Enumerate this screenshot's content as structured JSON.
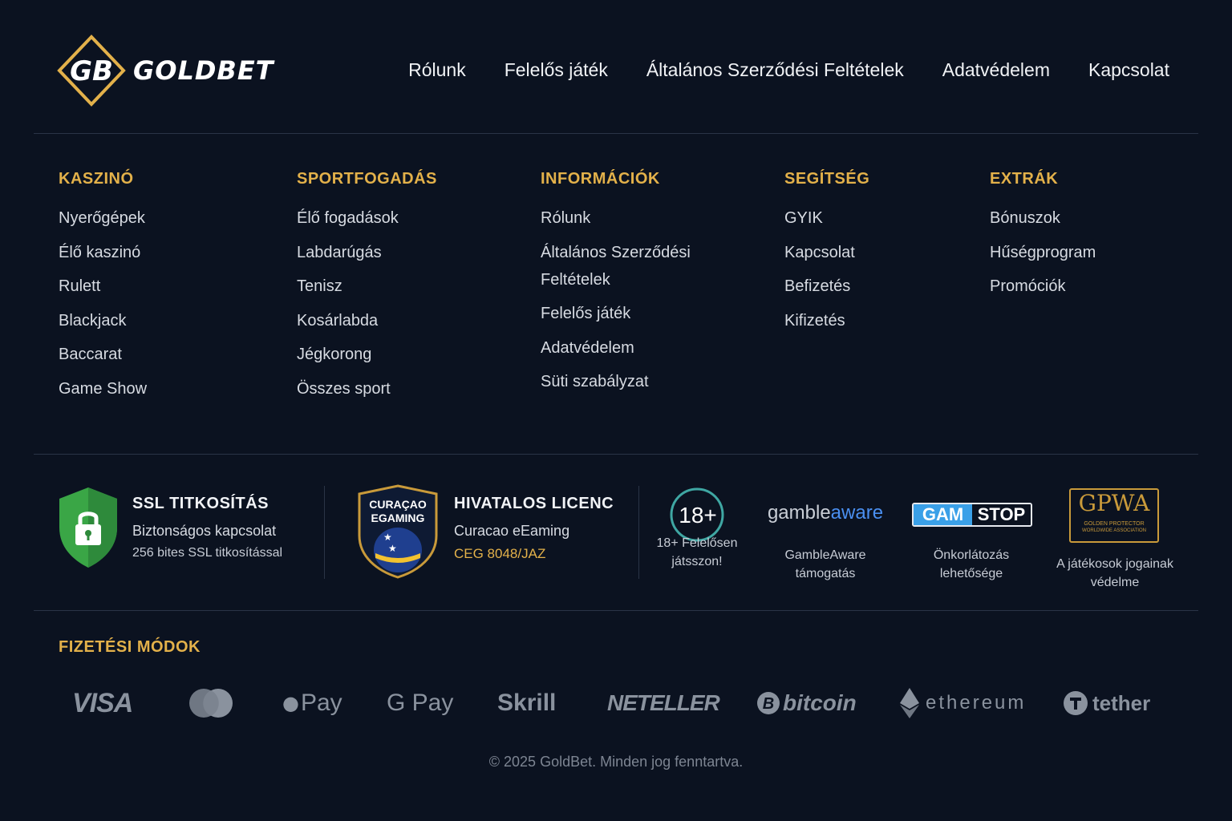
{
  "brand": {
    "logo_monogram": "GB",
    "name": "GOLDBET"
  },
  "topnav": [
    "Rólunk",
    "Felelős játék",
    "Általános Szerződési Feltételek",
    "Adatvédelem",
    "Kapcsolat"
  ],
  "columns": [
    {
      "title": "KASZINÓ",
      "items": [
        "Nyerőgépek",
        "Élő kaszinó",
        "Rulett",
        "Blackjack",
        "Baccarat",
        "Game Show"
      ]
    },
    {
      "title": "SPORTFOGADÁS",
      "items": [
        "Élő fogadások",
        "Labdarúgás",
        "Tenisz",
        "Kosárlabda",
        "Jégkorong",
        "Összes sport"
      ]
    },
    {
      "title": "INFORMÁCIÓK",
      "items": [
        "Rólunk",
        "Általános Szerződési Feltételek",
        "Felelős játék",
        "Adatvédelem",
        "Süti szabályzat"
      ]
    },
    {
      "title": "SEGÍTSÉG",
      "items": [
        "GYIK",
        "Kapcsolat",
        "Befizetés",
        "Kifizetés"
      ]
    },
    {
      "title": "EXTRÁK",
      "items": [
        "Bónuszok",
        "Hűségprogram",
        "Promóciók"
      ]
    }
  ],
  "ssl": {
    "title": "SSL TITKOSÍTÁS",
    "sub": "Biztonságos kapcsolat",
    "detail": "256 bites SSL titkosítással"
  },
  "license": {
    "seal_line1": "CURAÇAO",
    "seal_line2": "EGAMING",
    "title": "HIVATALOS LICENC",
    "sub": "Curacao eEaming",
    "code": "CEG 8048/JAZ"
  },
  "responsible": [
    {
      "mark": "18+",
      "caption_line1": "18+ Felelősen",
      "caption_line2": "játsszon!"
    },
    {
      "mark_a": "gamble",
      "mark_b": "aware",
      "caption_line1": "GambleAware",
      "caption_line2": "támogatás"
    },
    {
      "mark_a": "GAM",
      "mark_b": "STOP",
      "caption_line1": "Önkorlátozás",
      "caption_line2": "lehetősége"
    },
    {
      "mark": "GPWA",
      "mark_sub1": "GOLDEN PROTECTOR",
      "mark_sub2": "WORLDWIDE ASSOCIATION",
      "caption_line1": "A játékosok jogainak",
      "caption_line2": "védelme"
    }
  ],
  "payments": {
    "title": "FIZETÉSI MÓDOK",
    "methods": [
      "VISA",
      "Mastercard",
      "Pay",
      "G Pay",
      "Skrill",
      "NETELLER",
      "bitcoin",
      "ethereum",
      "tether"
    ]
  },
  "copyright": "© 2025 GoldBet. Minden jog fenntartva.",
  "colors": {
    "background": "#0b1220",
    "accent_gold": "#e3b14a",
    "divider": "#2a3446",
    "muted": "#8a929e",
    "gambleaware_blue": "#4a8ff0",
    "gamstop_blue": "#3aa0e8",
    "ssl_green": "#3aa646"
  }
}
